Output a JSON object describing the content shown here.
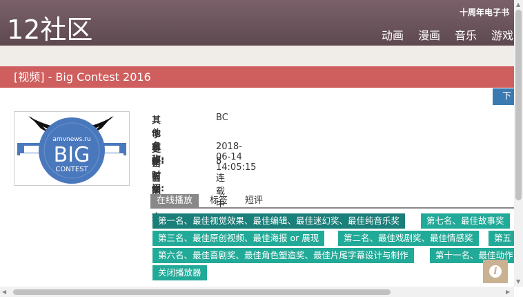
{
  "header": {
    "logo": "12社区",
    "top_link": "十周年电子书",
    "nav": [
      "动画",
      "漫画",
      "音乐",
      "游戏"
    ]
  },
  "title": "[视频] - Big Contest 2016",
  "download_label": "下",
  "cover": {
    "site": "amvnews.ru",
    "big": "BIG",
    "contest": "CONTEST"
  },
  "info": [
    {
      "label": "其他名称:",
      "value": "BC"
    },
    {
      "label": "字幕组:",
      "value": ""
    },
    {
      "label": "更新时间:",
      "value": "2018-06-14 14:05:15"
    },
    {
      "label": "当前集数:",
      "value": "8"
    },
    {
      "label": "当前状态:",
      "value": "连载中"
    }
  ],
  "tabs": [
    "在线播放",
    "标签",
    "短评"
  ],
  "episodes": [
    "第一名、最佳视觉效果、最佳编辑、最佳迷幻奖、最佳纯音乐奖",
    "第七名、最佳故事奖",
    "第三名、最佳原创视频、最佳海报 or 展现",
    "第二名、最佳戏剧奖、最佳情感奖",
    "第五",
    "第六名、最佳喜剧奖、最佳角色塑造奖、最佳片尾字幕设计与制作",
    "第十一名、最佳动作",
    "关闭播放器"
  ],
  "colors": {
    "header": "#6b5259",
    "title_bar": "#cf5f5e",
    "episode": "#22aa98",
    "episode_active": "#1a7e79",
    "download": "#3b7ab1",
    "info_button": "#c9b191"
  },
  "icons": {
    "info_button": "info-icon"
  }
}
